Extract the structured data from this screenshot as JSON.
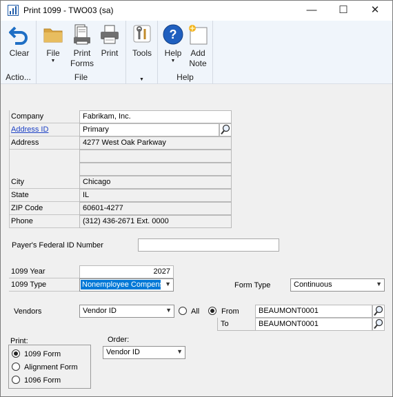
{
  "window": {
    "title": "Print 1099  -  TWO03 (sa)",
    "minimize": "—",
    "maximize": "☐",
    "close": "✕"
  },
  "ribbon": {
    "groups": [
      {
        "label": "Actio...",
        "buttons": [
          {
            "label": "Clear",
            "icon": "undo-arrow-icon"
          }
        ]
      },
      {
        "label": "File",
        "buttons": [
          {
            "label": "File",
            "icon": "folder-icon"
          },
          {
            "label": "Print Forms",
            "icon": "print-forms-icon"
          },
          {
            "label": "Print",
            "icon": "printer-icon"
          }
        ]
      },
      {
        "label": "",
        "buttons": [
          {
            "label": "Tools",
            "icon": "tools-icon"
          }
        ]
      },
      {
        "label": "Help",
        "buttons": [
          {
            "label": "Help",
            "icon": "help-icon"
          },
          {
            "label": "Add Note",
            "icon": "note-icon"
          }
        ]
      }
    ],
    "file_label": "File",
    "print_forms_label_1": "Print",
    "print_forms_label_2": "Forms",
    "add_note_1": "Add",
    "add_note_2": "Note"
  },
  "company": {
    "company_label": "Company",
    "company_value": "Fabrikam, Inc.",
    "address_id_label": "Address ID",
    "address_id_value": "Primary",
    "address_label": "Address",
    "address_line1": "4277 West Oak Parkway",
    "address_line2": "",
    "address_line3": "",
    "city_label": "City",
    "city_value": "Chicago",
    "state_label": "State",
    "state_value": "IL",
    "zip_label": "ZIP Code",
    "zip_value": "60601-4277",
    "phone_label": "Phone",
    "phone_value": "(312) 436-2671  Ext. 0000"
  },
  "payer": {
    "federal_id_label": "Payer's Federal ID Number",
    "federal_id_value": ""
  },
  "form": {
    "year_label": "1099 Year",
    "year_value": "2027",
    "type_label": "1099 Type",
    "type_value": "Nonemployee Compensa",
    "form_type_label": "Form Type",
    "form_type_value": "Continuous"
  },
  "vendors": {
    "label": "Vendors",
    "sort_value": "Vendor ID",
    "all_label": "All",
    "from_label": "From",
    "to_label": "To",
    "from_value": "BEAUMONT0001",
    "to_value": "BEAUMONT0001",
    "selected": "From"
  },
  "print": {
    "label": "Print:",
    "options": [
      "1099 Form",
      "Alignment Form",
      "1096 Form"
    ],
    "selected": "1099 Form"
  },
  "order": {
    "label": "Order:",
    "value": "Vendor ID"
  },
  "colors": {
    "ribbon_bg": "#f0f5fb",
    "selection": "#0078d7",
    "link": "#1a3fc4"
  }
}
